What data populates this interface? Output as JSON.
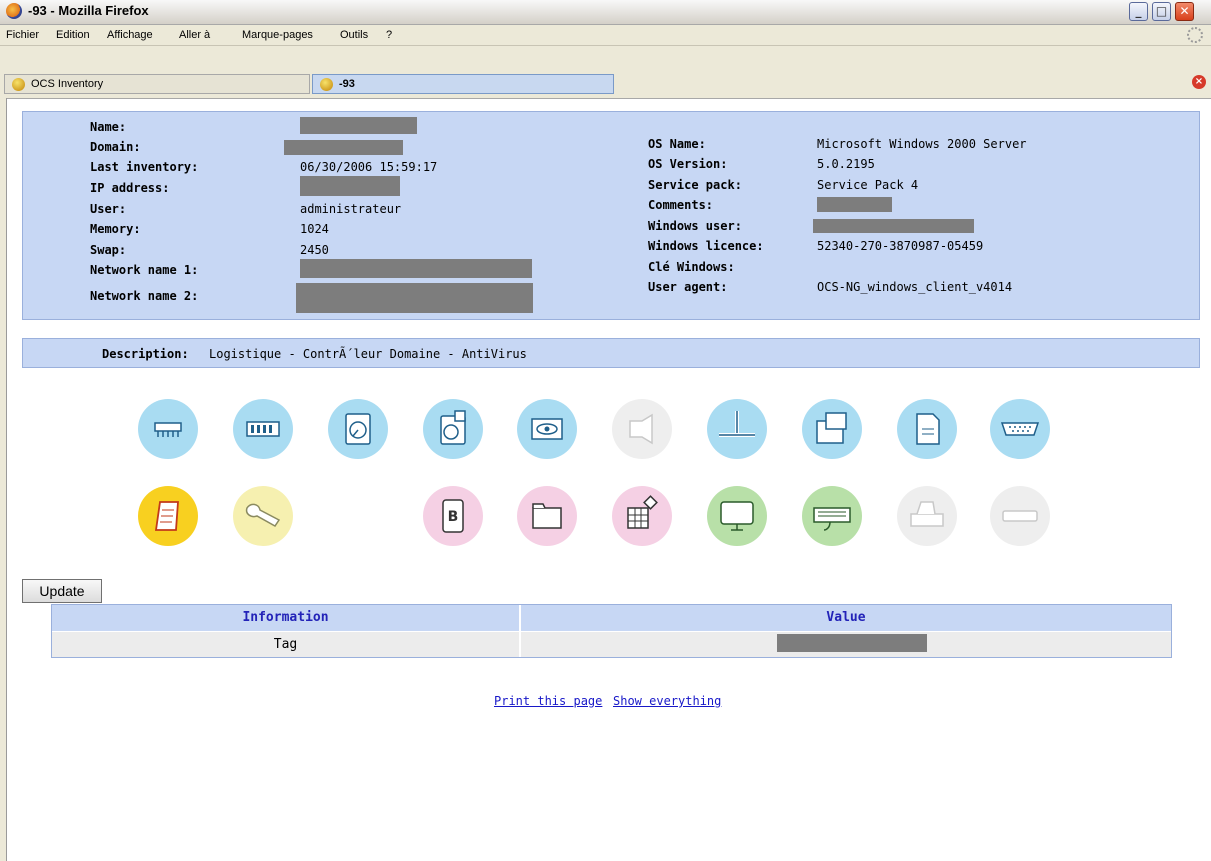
{
  "window": {
    "title": "-93 - Mozilla Firefox"
  },
  "menu": [
    "Fichier",
    "Edition",
    "Affichage",
    "Aller à",
    "Marque-pages",
    "Outils",
    "?"
  ],
  "tabs": [
    {
      "label": "OCS Inventory"
    },
    {
      "label": "-93"
    }
  ],
  "machine": {
    "left_labels": [
      "Name:",
      "Domain:",
      "Last inventory:",
      "IP address:",
      "User:",
      "Memory:",
      "Swap:",
      "Network name 1:",
      "Network name 2:"
    ],
    "last_inventory": "06/30/2006 15:59:17",
    "user": "administrateur",
    "memory": "1024",
    "swap": "2450",
    "right_labels": [
      "OS Name:",
      "OS Version:",
      "Service pack:",
      "Comments:",
      "Windows user:",
      "Windows licence:",
      "Clé Windows:",
      "User agent:"
    ],
    "os_name": "Microsoft Windows 2000 Server",
    "os_version": "5.0.2195",
    "service_pack": "Service Pack 4",
    "windows_licence": "52340-270-3870987-05459",
    "user_agent": "OCS-NG_windows_client_v4014"
  },
  "description": {
    "label": "Description:",
    "value": "Logistique - ContrÃ´leur Domaine - AntiVirus"
  },
  "update_label": "Update",
  "table": {
    "headers": [
      "Information",
      "Value"
    ],
    "row_label": "Tag"
  },
  "links": [
    "Print this page",
    "Show everything"
  ],
  "colors": {
    "panel": "#c7d7f4",
    "header_text": "#2323b8",
    "link": "#1818c8"
  }
}
